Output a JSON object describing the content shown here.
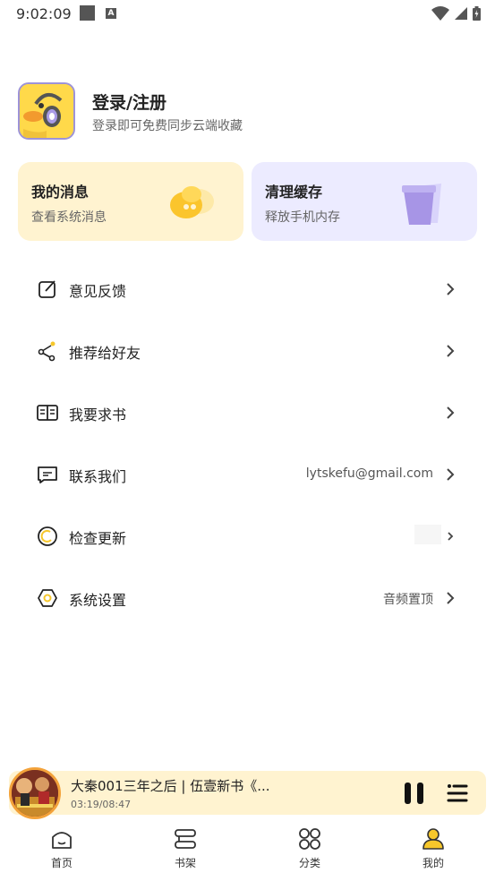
{
  "status_bar": {
    "time": "9:02:09",
    "notif_badge": "A"
  },
  "profile": {
    "title": "登录/注册",
    "subtitle": "登录即可免费同步云端收藏"
  },
  "cards": {
    "messages": {
      "title": "我的消息",
      "subtitle": "查看系统消息"
    },
    "cache": {
      "title": "清理缓存",
      "subtitle": "释放手机内存"
    }
  },
  "menu": [
    {
      "label": "意见反馈",
      "value": ""
    },
    {
      "label": "推荐给好友",
      "value": ""
    },
    {
      "label": "我要求书",
      "value": ""
    },
    {
      "label": "联系我们",
      "value": "lytskefu@gmail.com"
    },
    {
      "label": "检查更新",
      "value": ""
    },
    {
      "label": "系统设置",
      "value": "音频置顶"
    }
  ],
  "player": {
    "title": "大秦001三年之后 | 伍壹新书《...",
    "time": "03:19/08:47"
  },
  "tabs": [
    {
      "label": "首页",
      "icon": "home-icon"
    },
    {
      "label": "书架",
      "icon": "bookshelf-icon"
    },
    {
      "label": "分类",
      "icon": "category-icon"
    },
    {
      "label": "我的",
      "icon": "profile-icon"
    }
  ],
  "colors": {
    "accent_yellow": "#fff3d0",
    "accent_purple": "#ecebff",
    "active_tab": "#f6c72b"
  }
}
